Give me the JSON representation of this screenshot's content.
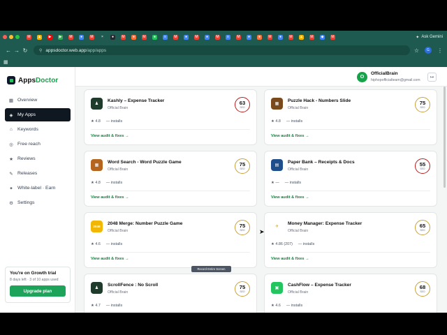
{
  "browser": {
    "url_host": "appsdoctor.web.app",
    "url_path": "/app/apps",
    "gemini_label": "Ask Gemini",
    "profile_initial": "G",
    "tab_icons": [
      {
        "name": "gmail-icon",
        "color": "#e94235",
        "glyph": "M"
      },
      {
        "name": "drive-icon",
        "color": "#f4b400",
        "glyph": "▲"
      },
      {
        "name": "youtube-icon",
        "color": "#ff0000",
        "glyph": "▶"
      },
      {
        "name": "play-icon",
        "color": "#34a853",
        "glyph": "▶"
      },
      {
        "name": "gmail-icon",
        "color": "#e94235",
        "glyph": "M"
      },
      {
        "name": "chrome-icon",
        "color": "#4285f4",
        "glyph": "●"
      },
      {
        "name": "gmail-icon",
        "color": "#e94235",
        "glyph": "M"
      },
      {
        "name": "close-icon",
        "color": "#1e5a4f",
        "glyph": "×"
      },
      {
        "name": "github-icon",
        "color": "#24292f",
        "glyph": "●"
      },
      {
        "name": "gmail-icon",
        "color": "#e94235",
        "glyph": "M"
      },
      {
        "name": "firefox-icon",
        "color": "#ff7139",
        "glyph": "●"
      },
      {
        "name": "gmail-icon",
        "color": "#e94235",
        "glyph": "M"
      },
      {
        "name": "app-icon",
        "color": "#22c55e",
        "glyph": "●"
      },
      {
        "name": "docs-icon",
        "color": "#4285f4",
        "glyph": "≡"
      },
      {
        "name": "gmail-icon",
        "color": "#e94235",
        "glyph": "M"
      },
      {
        "name": "chrome-icon",
        "color": "#4285f4",
        "glyph": "●"
      },
      {
        "name": "gmail-icon",
        "color": "#e94235",
        "glyph": "M"
      },
      {
        "name": "chrome-icon",
        "color": "#4285f4",
        "glyph": "●"
      },
      {
        "name": "gmail-icon",
        "color": "#e94235",
        "glyph": "M"
      },
      {
        "name": "docs-icon",
        "color": "#4285f4",
        "glyph": "≡"
      },
      {
        "name": "gmail-icon",
        "color": "#e94235",
        "glyph": "M"
      },
      {
        "name": "chrome-icon",
        "color": "#4285f4",
        "glyph": "●"
      },
      {
        "name": "firefox-icon",
        "color": "#ff7139",
        "glyph": "●"
      },
      {
        "name": "gmail-icon",
        "color": "#e94235",
        "glyph": "M"
      },
      {
        "name": "chrome-icon",
        "color": "#4285f4",
        "glyph": "●"
      },
      {
        "name": "gmail-icon",
        "color": "#e94235",
        "glyph": "M"
      },
      {
        "name": "drive-icon",
        "color": "#f4b400",
        "glyph": "▲"
      },
      {
        "name": "gmail-icon",
        "color": "#e94235",
        "glyph": "M"
      },
      {
        "name": "gem-icon",
        "color": "#3b82f6",
        "glyph": "◆"
      },
      {
        "name": "gmail-icon",
        "color": "#e94235",
        "glyph": "M"
      }
    ]
  },
  "brand": {
    "name_dark": "Apps",
    "name_accent": "Doctor"
  },
  "nav": [
    {
      "label": "Overview",
      "icon": "▦",
      "icon_name": "grid-icon",
      "active": false
    },
    {
      "label": "My Apps",
      "icon": "◈",
      "icon_name": "layers-icon",
      "active": true
    },
    {
      "label": "Keywords",
      "icon": "⌂",
      "icon_name": "tag-icon",
      "active": false
    },
    {
      "label": "Free reach",
      "icon": "◎",
      "icon_name": "globe-icon",
      "active": false
    },
    {
      "label": "Reviews",
      "icon": "★",
      "icon_name": "star-icon",
      "active": false
    },
    {
      "label": "Releases",
      "icon": "✎",
      "icon_name": "rocket-icon",
      "active": false
    },
    {
      "label": "White-label · Earn",
      "icon": "✦",
      "icon_name": "sparkle-icon",
      "active": false
    },
    {
      "label": "Settings",
      "icon": "⚙",
      "icon_name": "gear-icon",
      "active": false
    }
  ],
  "trial": {
    "title": "You're on Growth trial",
    "subtitle": "8 days left · 3 of 10 apps used",
    "button": "Upgrade plan"
  },
  "user": {
    "initial": "O",
    "name": "OfficialBrain",
    "email": "hiphopofficialteam@gmail.com",
    "logout_icon": "↦"
  },
  "audit_label": "View audit & fixes →",
  "score_unit": "SEO",
  "apps": [
    {
      "name": "Kashly – Expense Tracker",
      "developer": "Official Brain",
      "rating": "★ 4.8",
      "installs": "— installs",
      "score": "63",
      "score_color": "#b91c1c",
      "icon_bg": "#1f3b2b",
      "icon_glyph": "♟"
    },
    {
      "name": "Puzzle Hack - Numbers Slide",
      "developer": "Official Brain",
      "rating": "★ 4.8",
      "installs": "— installs",
      "score": "75",
      "score_color": "#c9a13b",
      "icon_bg": "#7a4a1c",
      "icon_glyph": "▦"
    },
    {
      "name": "Word Search - Word Puzzle Game",
      "developer": "Official Brain",
      "rating": "★ 4.8",
      "installs": "— installs",
      "score": "75",
      "score_color": "#c9a13b",
      "icon_bg": "#b5651d",
      "icon_glyph": "▦"
    },
    {
      "name": "Paper Bank – Receipts & Docs",
      "developer": "Official Brain",
      "rating": "★ —",
      "installs": "— installs",
      "score": "55",
      "score_color": "#b91c1c",
      "icon_bg": "#1e4e8c",
      "icon_glyph": "▤"
    },
    {
      "name": "2048 Merge: Number Puzzle Game",
      "developer": "Official Brain",
      "rating": "★ 4.6",
      "installs": "— installs",
      "score": "75",
      "score_color": "#c9a13b",
      "icon_bg": "#f2b705",
      "icon_glyph": "2048"
    },
    {
      "name": "Money Manager: Expense Tracker",
      "developer": "Official Brain",
      "rating": "★ 4.86 (207)",
      "installs": "— installs",
      "score": "65",
      "score_color": "#c9a13b",
      "icon_bg": "#ffffff",
      "icon_glyph": "✈"
    },
    {
      "name": "ScrollFence : No Scroll",
      "developer": "Official Brain",
      "rating": "★ 4.7",
      "installs": "— installs",
      "score": "75",
      "score_color": "#c9a13b",
      "icon_bg": "#1f3b2b",
      "icon_glyph": "♟"
    },
    {
      "name": "CashFlow – Expense Tracker",
      "developer": "Official Brain",
      "rating": "★ 4.6",
      "installs": "— installs",
      "score": "68",
      "score_color": "#c9a13b",
      "icon_bg": "#22c55e",
      "icon_glyph": "▣"
    }
  ],
  "tooltip": "Record Entire Screen"
}
